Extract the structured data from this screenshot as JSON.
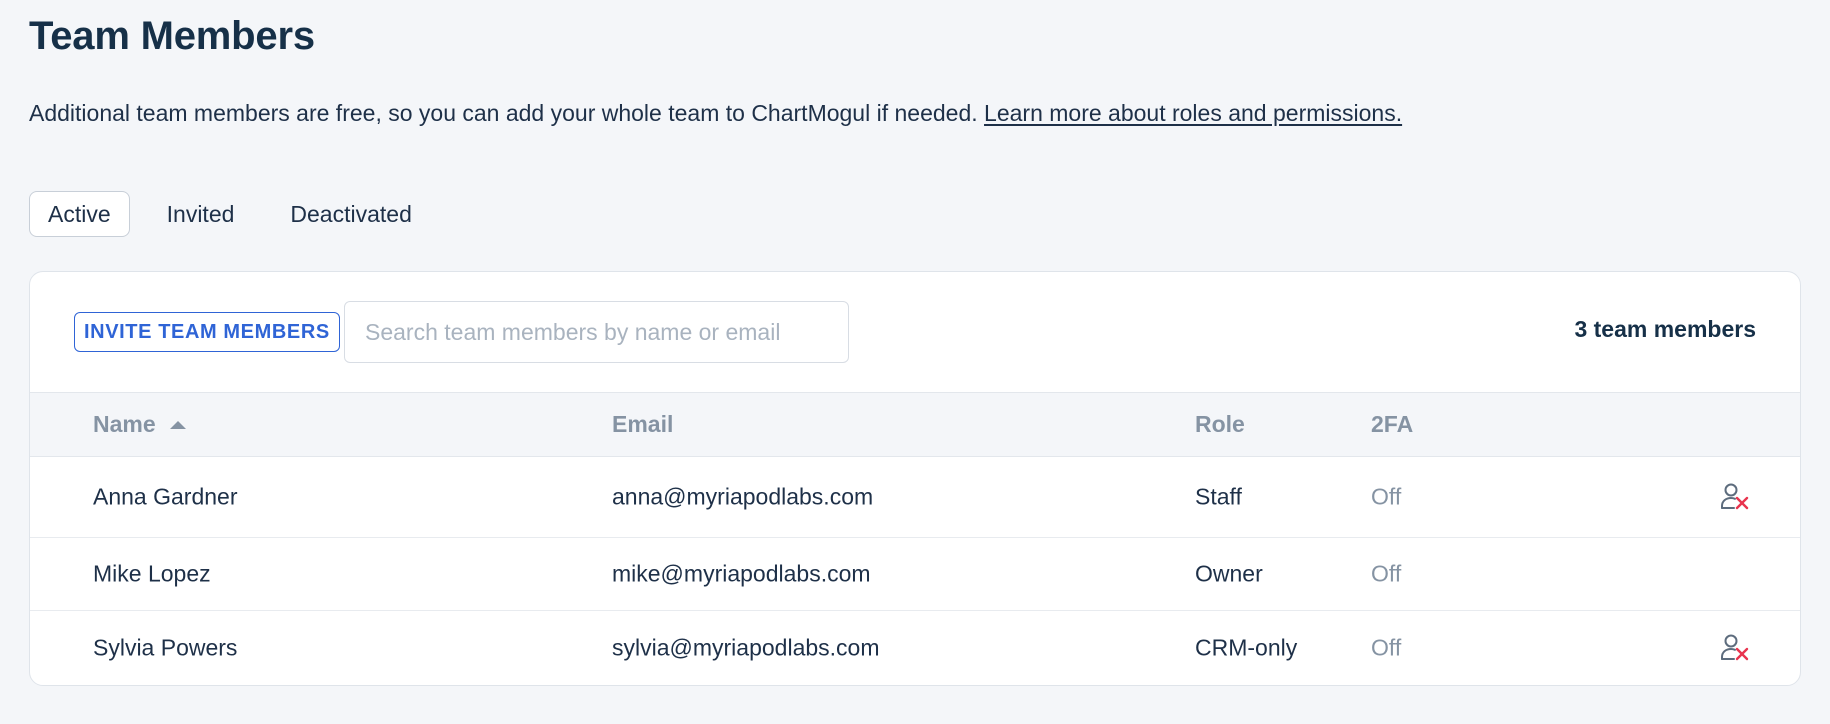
{
  "header": {
    "title": "Team Members",
    "intro_text": "Additional team members are free, so you can add your whole team to ChartMogul if needed. ",
    "intro_link": "Learn more about roles and permissions."
  },
  "tabs": [
    {
      "label": "Active",
      "selected": true
    },
    {
      "label": "Invited",
      "selected": false
    },
    {
      "label": "Deactivated",
      "selected": false
    }
  ],
  "toolbar": {
    "invite_label": "INVITE TEAM MEMBERS",
    "search_placeholder": "Search team members by name or email",
    "count_label": "3 team members"
  },
  "table": {
    "columns": [
      "Name",
      "Email",
      "Role",
      "2FA"
    ],
    "sort": {
      "column": "Name",
      "direction": "ascending"
    },
    "rows": [
      {
        "name": "Anna Gardner",
        "email": "anna@myriapodlabs.com",
        "role": "Staff",
        "tfa": "Off",
        "removable": true
      },
      {
        "name": "Mike Lopez",
        "email": "mike@myriapodlabs.com",
        "role": "Owner",
        "tfa": "Off",
        "removable": false
      },
      {
        "name": "Sylvia Powers",
        "email": "sylvia@myriapodlabs.com",
        "role": "CRM-only",
        "tfa": "Off",
        "removable": true
      }
    ]
  },
  "icons": {
    "sort": "sort-ascending-icon",
    "remove": "remove-user-icon"
  },
  "colors": {
    "accent": "#2f64d6",
    "danger": "#e8344e",
    "text": "#1e3048",
    "muted": "#8593a3",
    "background": "#f4f6f9"
  }
}
